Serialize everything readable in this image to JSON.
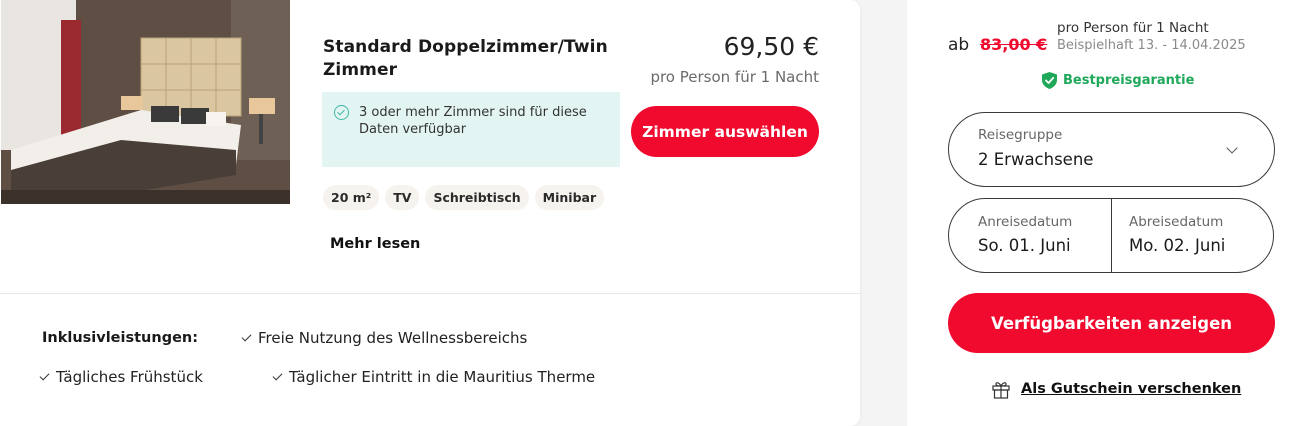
{
  "room": {
    "image_alt": "Hotel room with double bed",
    "title": "Standard Doppelzimmer/Twin Zimmer",
    "availability_note": "3 oder mehr Zimmer sind für diese Daten verfügbar",
    "price": "69,50 €",
    "price_unit": "pro Person für 1 Nacht",
    "select_button": "Zimmer auswählen",
    "features": [
      "20 m²",
      "TV",
      "Schreibtisch",
      "Minibar"
    ],
    "more_link": "Mehr lesen"
  },
  "inclusions": {
    "label": "Inklusivleistungen:",
    "items": [
      "Freie Nutzung des Wellnessbereichs",
      "Tägliches Frühstück",
      "Täglicher Eintritt in die Mauritius Therme"
    ]
  },
  "booking": {
    "from_label": "ab",
    "old_price": "83,00 €",
    "price_note": "pro Person für 1 Nacht",
    "example_dates": "Beispielhaft 13. - 14.04.2025",
    "guarantee": "Bestpreisgarantie",
    "group_label": "Reisegruppe",
    "group_value": "2 Erwachsene",
    "arrival_label": "Anreisedatum",
    "arrival_value": "So. 01. Juni",
    "departure_label": "Abreisedatum",
    "departure_value": "Mo. 02. Juni",
    "availability_button": "Verfügbarkeiten anzeigen",
    "gift_link": "Als Gutschein verschenken"
  },
  "colors": {
    "accent_red": "#ef0a2e",
    "guarantee_green": "#1fa85a",
    "availability_bg": "#e3f5f3"
  }
}
